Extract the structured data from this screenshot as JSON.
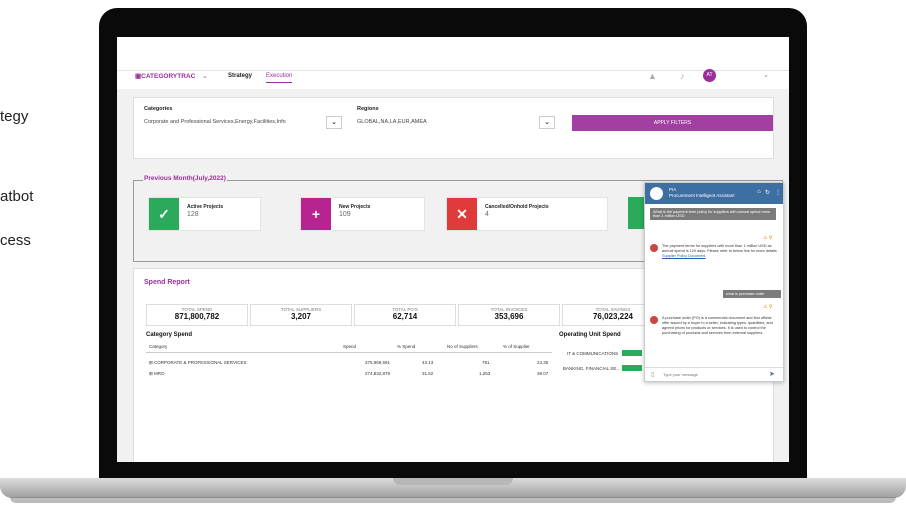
{
  "left_text": [
    "tegy",
    "atbot",
    "cess"
  ],
  "app": {
    "logo": "CATEGORYTRAC",
    "tabs": [
      {
        "label": "Strategy"
      },
      {
        "label": "Execution"
      }
    ],
    "avatar": "AT"
  },
  "filters": {
    "categories_label": "Categories",
    "categories_value": "Corporate and Professional Services,Energy,Facilities,Info",
    "regions_label": "Regions",
    "regions_value": "GLOBAL,NA,LA,EUR,AMEA",
    "apply_label": "APPLY FILTERS"
  },
  "previous_month": {
    "title": "Previous Month(July,2022)",
    "stats": [
      {
        "title": "Active Projects",
        "value": "128",
        "color": "#2aaa5a",
        "icon": "✓"
      },
      {
        "title": "New Projects",
        "value": "109",
        "color": "#b8248f",
        "icon": "+"
      },
      {
        "title": "Cancelled/Onhold Projects",
        "value": "4",
        "color": "#e03a3a",
        "icon": "✕"
      }
    ]
  },
  "spend_report": {
    "title": "Spend Report",
    "kpis": [
      {
        "label": "TOTAL SPEND",
        "value": "871,800,782"
      },
      {
        "label": "TOTAL SUPPLIERS",
        "value": "3,207"
      },
      {
        "label": "TOTAL PO'S",
        "value": "62,714"
      },
      {
        "label": "TOTAL INVOICES",
        "value": "353,696"
      },
      {
        "label": "TOTAL SAVINGS",
        "value": "76,023,224"
      }
    ],
    "category_spend": {
      "title": "Category Spend",
      "headers": [
        "Category",
        "Spend",
        "% Spend",
        "No of Suppliers",
        "% of Supplier"
      ],
      "rows": [
        {
          "c": "CORPORATE & PROFESSIONAL SERVICES",
          "s": "375,969,591",
          "p": "43.13",
          "n": "781",
          "ps": "24.35"
        },
        {
          "c": "MRO",
          "s": "274,832,879",
          "p": "31.52",
          "n": "1,253",
          "ps": "39.07"
        }
      ]
    },
    "operating_unit": {
      "title": "Operating Unit Spend",
      "rows": [
        {
          "label": "IT & COMMUNICATIONS"
        },
        {
          "label": "BANKING, FINANCIAL SE..."
        }
      ]
    }
  },
  "chat": {
    "name": "PIA",
    "subtitle": "Procurement Intelligent Assistant",
    "q1": "What is the payment term policy for suppliers with annual spend more than 1 million USD",
    "a1": "The payment terms for suppliers with more than 1 million USD as annual spend is 120 days. Please refer to below link for more details",
    "a1_link": "Supplier Policy Document",
    "q2": "what is purchase order",
    "a2": "A purchase order (PO) is a commercial document and first official offer issued by a buyer to a seller, indicating types, quantities, and agreed prices for products or services. It is used to control the purchasing of products and services from external suppliers.",
    "placeholder": "Type your message"
  },
  "colors": {
    "accent": "#9b2e9b",
    "chat_header": "#3e6fa3",
    "green": "#2aaa5a"
  }
}
